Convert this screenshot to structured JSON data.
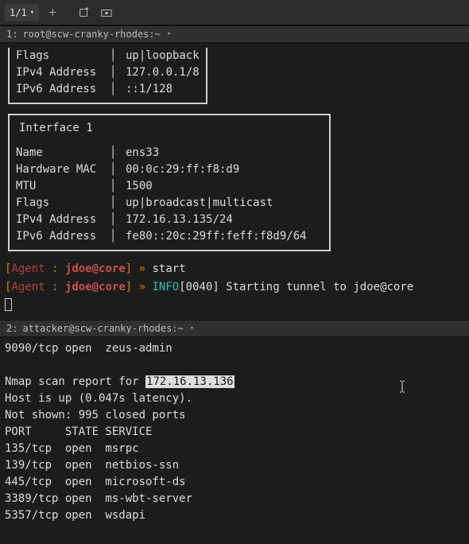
{
  "toolbar": {
    "tab_counter": "1/1"
  },
  "pane1": {
    "index": "1:",
    "title": "root@scw-cranky-rhodes:~",
    "iface0": {
      "flags_k": "Flags",
      "flags_v": "up|loopback",
      "ipv4_k": "IPv4 Address",
      "ipv4_v": "127.0.0.1/8",
      "ipv6_k": "IPv6 Address",
      "ipv6_v": "::1/128"
    },
    "iface1": {
      "title": "Interface 1",
      "name_k": "Name",
      "name_v": "ens33",
      "mac_k": "Hardware MAC",
      "mac_v": "00:0c:29:ff:f8:d9",
      "mtu_k": "MTU",
      "mtu_v": "1500",
      "flags_k": "Flags",
      "flags_v": "up|broadcast|multicast",
      "ipv4_k": "IPv4 Address",
      "ipv4_v": "172.16.13.135/24",
      "ipv6_k": "IPv6 Address",
      "ipv6_v": "fe80::20c:29ff:feff:f8d9/64"
    },
    "prompt": {
      "open": "[",
      "agent": "Agent",
      "colon": " : ",
      "session": "jdoe@core",
      "close": "]",
      "arrow": " » ",
      "cmd1": "start",
      "info_tag": "INFO",
      "info_msg": "[0040] Starting tunnel to jdoe@core"
    }
  },
  "pane2": {
    "index": "2:",
    "title": "attacker@scw-cranky-rhodes:~",
    "lines": {
      "l0": "9090/tcp open  zeus-admin",
      "scan_prefix": "Nmap scan report for ",
      "scan_ip": "172.16.13.136",
      "host": "Host is up (0.047s latency).",
      "notshown": "Not shown: 995 closed ports",
      "header": "PORT     STATE SERVICE",
      "p1": "135/tcp  open  msrpc",
      "p2": "139/tcp  open  netbios-ssn",
      "p3": "445/tcp  open  microsoft-ds",
      "p4": "3389/tcp open  ms-wbt-server",
      "p5": "5357/tcp open  wsdapi"
    }
  }
}
